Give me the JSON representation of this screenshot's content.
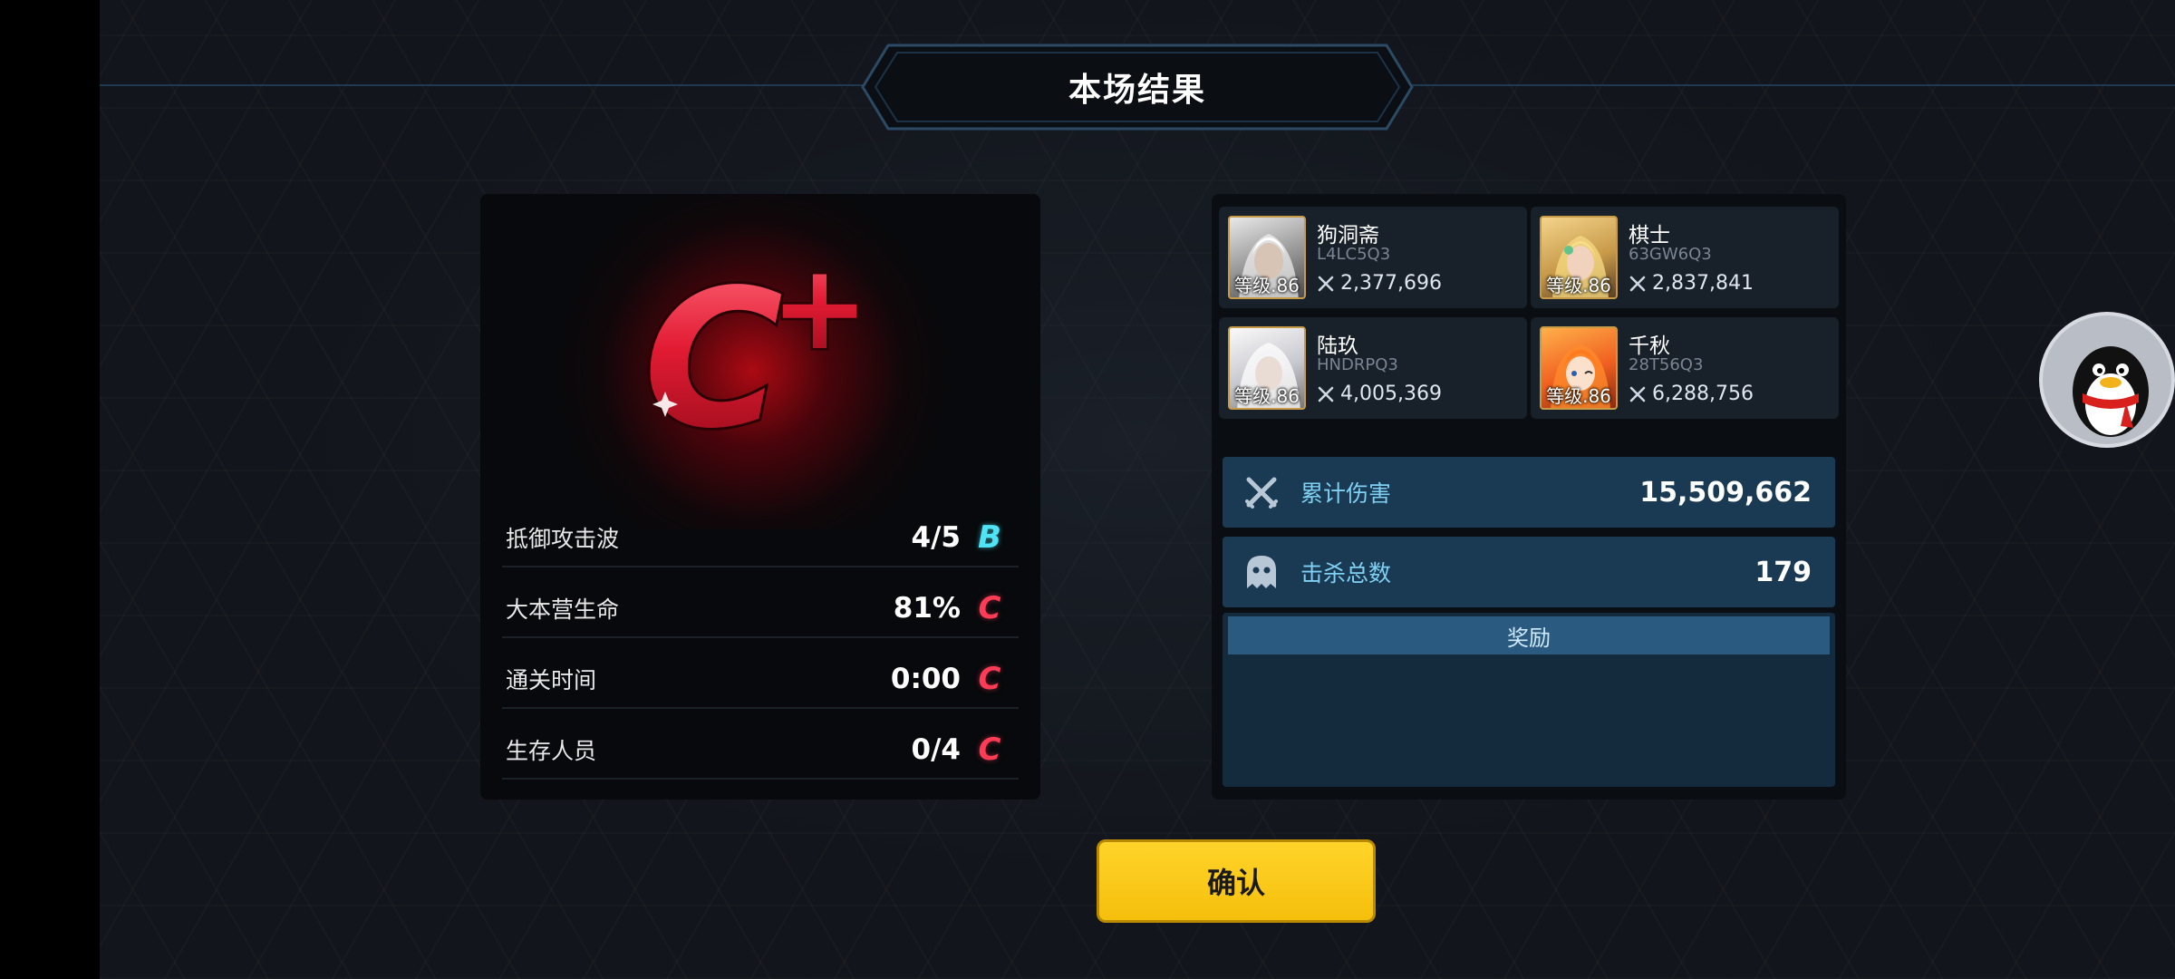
{
  "header": {
    "title": "本场结果"
  },
  "grade": {
    "letter": "C",
    "modifier": "+"
  },
  "stats": [
    {
      "label": "抵御攻击波",
      "value": "4/5",
      "rank": "B"
    },
    {
      "label": "大本营生命",
      "value": "81%",
      "rank": "C"
    },
    {
      "label": "通关时间",
      "value": "0:00",
      "rank": "C"
    },
    {
      "label": "生存人员",
      "value": "0/4",
      "rank": "C"
    }
  ],
  "players": [
    {
      "name": "狗洞斋",
      "id": "L4LC5Q3",
      "power": "2,377,696",
      "level": "等级.86"
    },
    {
      "name": "棋士",
      "id": "63GW6Q3",
      "power": "2,837,841",
      "level": "等级.86"
    },
    {
      "name": "陆玖",
      "id": "HNDRPQ3",
      "power": "4,005,369",
      "level": "等级.86"
    },
    {
      "name": "千秋",
      "id": "28T56Q3",
      "power": "6,288,756",
      "level": "等级.86"
    }
  ],
  "totals": {
    "damage_label": "累计伤害",
    "damage_value": "15,509,662",
    "kills_label": "击杀总数",
    "kills_value": "179"
  },
  "reward": {
    "title": "奖励"
  },
  "confirm": {
    "label": "确认"
  },
  "colors": {
    "accent_yellow": "#ffd42a",
    "rank_b": "#4fe3f5",
    "rank_c": "#ff3b55",
    "panel_blue": "#1a3a54"
  }
}
